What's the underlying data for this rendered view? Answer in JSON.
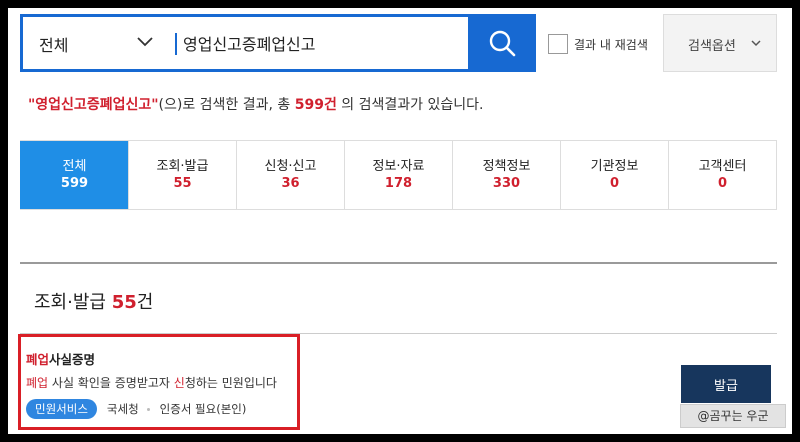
{
  "search": {
    "category": "전체",
    "query": "영업신고증폐업신고",
    "recheck_label": "결과 내 재검색",
    "options_label": "검색옵션"
  },
  "summary": {
    "query_quoted": "\"영업신고증폐업신고\"",
    "text_before_count": "(으)로 검색한 결과, 총 ",
    "total": "599",
    "unit": "건",
    "text_after_count": " 의 검색결과가 있습니다."
  },
  "tabs": [
    {
      "label": "전체",
      "count": "599"
    },
    {
      "label": "조회·발급",
      "count": "55"
    },
    {
      "label": "신청·신고",
      "count": "36"
    },
    {
      "label": "정보·자료",
      "count": "178"
    },
    {
      "label": "정책정보",
      "count": "330"
    },
    {
      "label": "기관정보",
      "count": "0"
    },
    {
      "label": "고객센터",
      "count": "0"
    }
  ],
  "section": {
    "title": "조회·발급",
    "count": "55",
    "unit": "건"
  },
  "result": {
    "title_hl": "폐업",
    "title_rest": "사실증명",
    "desc_hl1": "폐업",
    "desc_mid": " 사실 확인을 증명받고자 ",
    "desc_hl2": "신",
    "desc_end": "청하는 민원입니다",
    "category_pill": "민원서비스",
    "agency": "국세청",
    "requirement": "인증서 필요(본인)",
    "action_label": "발급"
  },
  "watermark": "@곰꾸는 우군",
  "colors": {
    "primary": "#1769d2",
    "tab_active": "#1f8ee6",
    "accent_red": "#d0202e",
    "button_dark": "#17365d",
    "highlight_box": "#d91f26"
  }
}
